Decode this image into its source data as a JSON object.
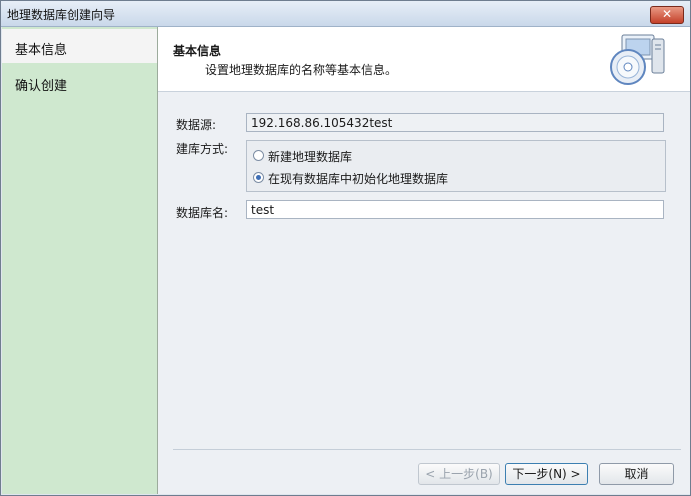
{
  "window": {
    "title": "地理数据库创建向导",
    "close_glyph": "✕"
  },
  "steps": [
    {
      "label": "基本信息",
      "active": true
    },
    {
      "label": "确认创建",
      "active": false
    }
  ],
  "header": {
    "title": "基本信息",
    "subtitle": "设置地理数据库的名称等基本信息。",
    "icon": "database-disc-icon"
  },
  "form": {
    "datasource_label": "数据源:",
    "datasource_value": "192.168.86.105432test",
    "method_label": "建库方式:",
    "options": [
      {
        "label": "新建地理数据库",
        "checked": false
      },
      {
        "label": "在现有数据库中初始化地理数据库",
        "checked": true
      }
    ],
    "dbname_label": "数据库名:",
    "dbname_value": "test"
  },
  "buttons": {
    "prev": "< 上一步(B)",
    "next": "下一步(N) >",
    "cancel": "取消"
  }
}
